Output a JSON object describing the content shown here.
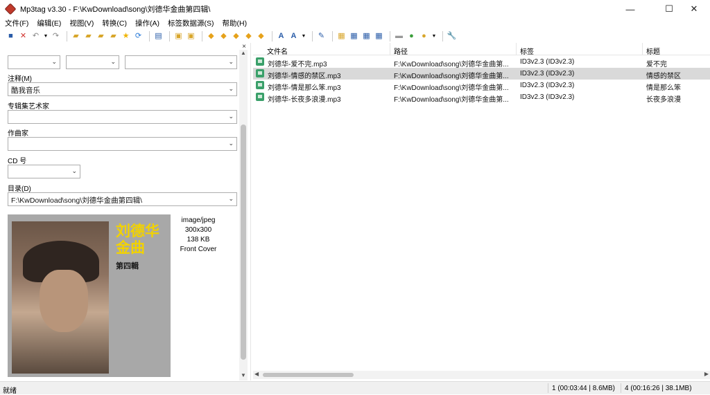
{
  "window": {
    "title": "Mp3tag v3.30  -  F:\\KwDownload\\song\\刘德华金曲第四辑\\",
    "minimize": "—",
    "maximize": "☐",
    "close": "✕"
  },
  "menu": [
    "文件(F)",
    "编辑(E)",
    "视图(V)",
    "转换(C)",
    "操作(A)",
    "标签数据源(S)",
    "帮助(H)"
  ],
  "toolbar_icons": [
    "save-icon",
    "remove-tag-icon",
    "undo-icon",
    "undo-dropdown-icon",
    "redo-icon",
    "add-folder-icon",
    "open-folder-icon",
    "save-playlist-icon",
    "export-icon",
    "favorite-star-icon",
    "refresh-icon",
    "tag-panel-icon",
    "copy-tag-icon",
    "paste-tag-icon",
    "tag-filename-icon",
    "filename-tag-icon",
    "text-file-tag-icon",
    "tag-tag-icon",
    "autonumber-icon",
    "case-convert-icon",
    "case-convert-dropdown-icon",
    "edit-icon",
    "actions-icon",
    "action-group-icon",
    "quick-action-icon",
    "export-file-icon",
    "freedb-icon",
    "web-sources-icon",
    "web-sources-dropdown-icon",
    "settings-icon"
  ],
  "left_panel": {
    "close_glyph": "×",
    "comment": {
      "label": "注释(M)",
      "value": "酷我音乐"
    },
    "album_artist": {
      "label": "专辑集艺术家",
      "value": ""
    },
    "composer": {
      "label": "作曲家",
      "value": ""
    },
    "cd": {
      "label": "CD 号",
      "value": ""
    },
    "directory": {
      "label": "目录(D)",
      "value": "F:\\KwDownload\\song\\刘德华金曲第四辑\\"
    },
    "cover": {
      "title_line1": "刘德华",
      "title_line2": "金曲",
      "subtitle": "第四輯"
    },
    "image_info": {
      "mime": "image/jpeg",
      "dimensions": "300x300",
      "size": "138 KB",
      "type": "Front Cover"
    }
  },
  "file_list": {
    "columns": [
      "文件名",
      "路径",
      "标签",
      "标题"
    ],
    "rows": [
      {
        "filename": "刘德华-爱不完.mp3",
        "path": "F:\\KwDownload\\song\\刘德华金曲第...",
        "tag": "ID3v2.3 (ID3v2.3)",
        "title": "爱不完",
        "selected": false
      },
      {
        "filename": "刘德华-情感的禁区.mp3",
        "path": "F:\\KwDownload\\song\\刘德华金曲第...",
        "tag": "ID3v2.3 (ID3v2.3)",
        "title": "情感的禁区",
        "selected": true
      },
      {
        "filename": "刘德华-情是那么笨.mp3",
        "path": "F:\\KwDownload\\song\\刘德华金曲第...",
        "tag": "ID3v2.3 (ID3v2.3)",
        "title": "情是那么笨",
        "selected": false
      },
      {
        "filename": "刘德华-长夜多浪漫.mp3",
        "path": "F:\\KwDownload\\song\\刘德华金曲第...",
        "tag": "ID3v2.3 (ID3v2.3)",
        "title": "长夜多浪漫",
        "selected": false
      }
    ]
  },
  "status": {
    "left": "就绪",
    "selected": "1 (00:03:44 | 8.6MB)",
    "total": "4 (00:16:26 | 38.1MB)"
  }
}
